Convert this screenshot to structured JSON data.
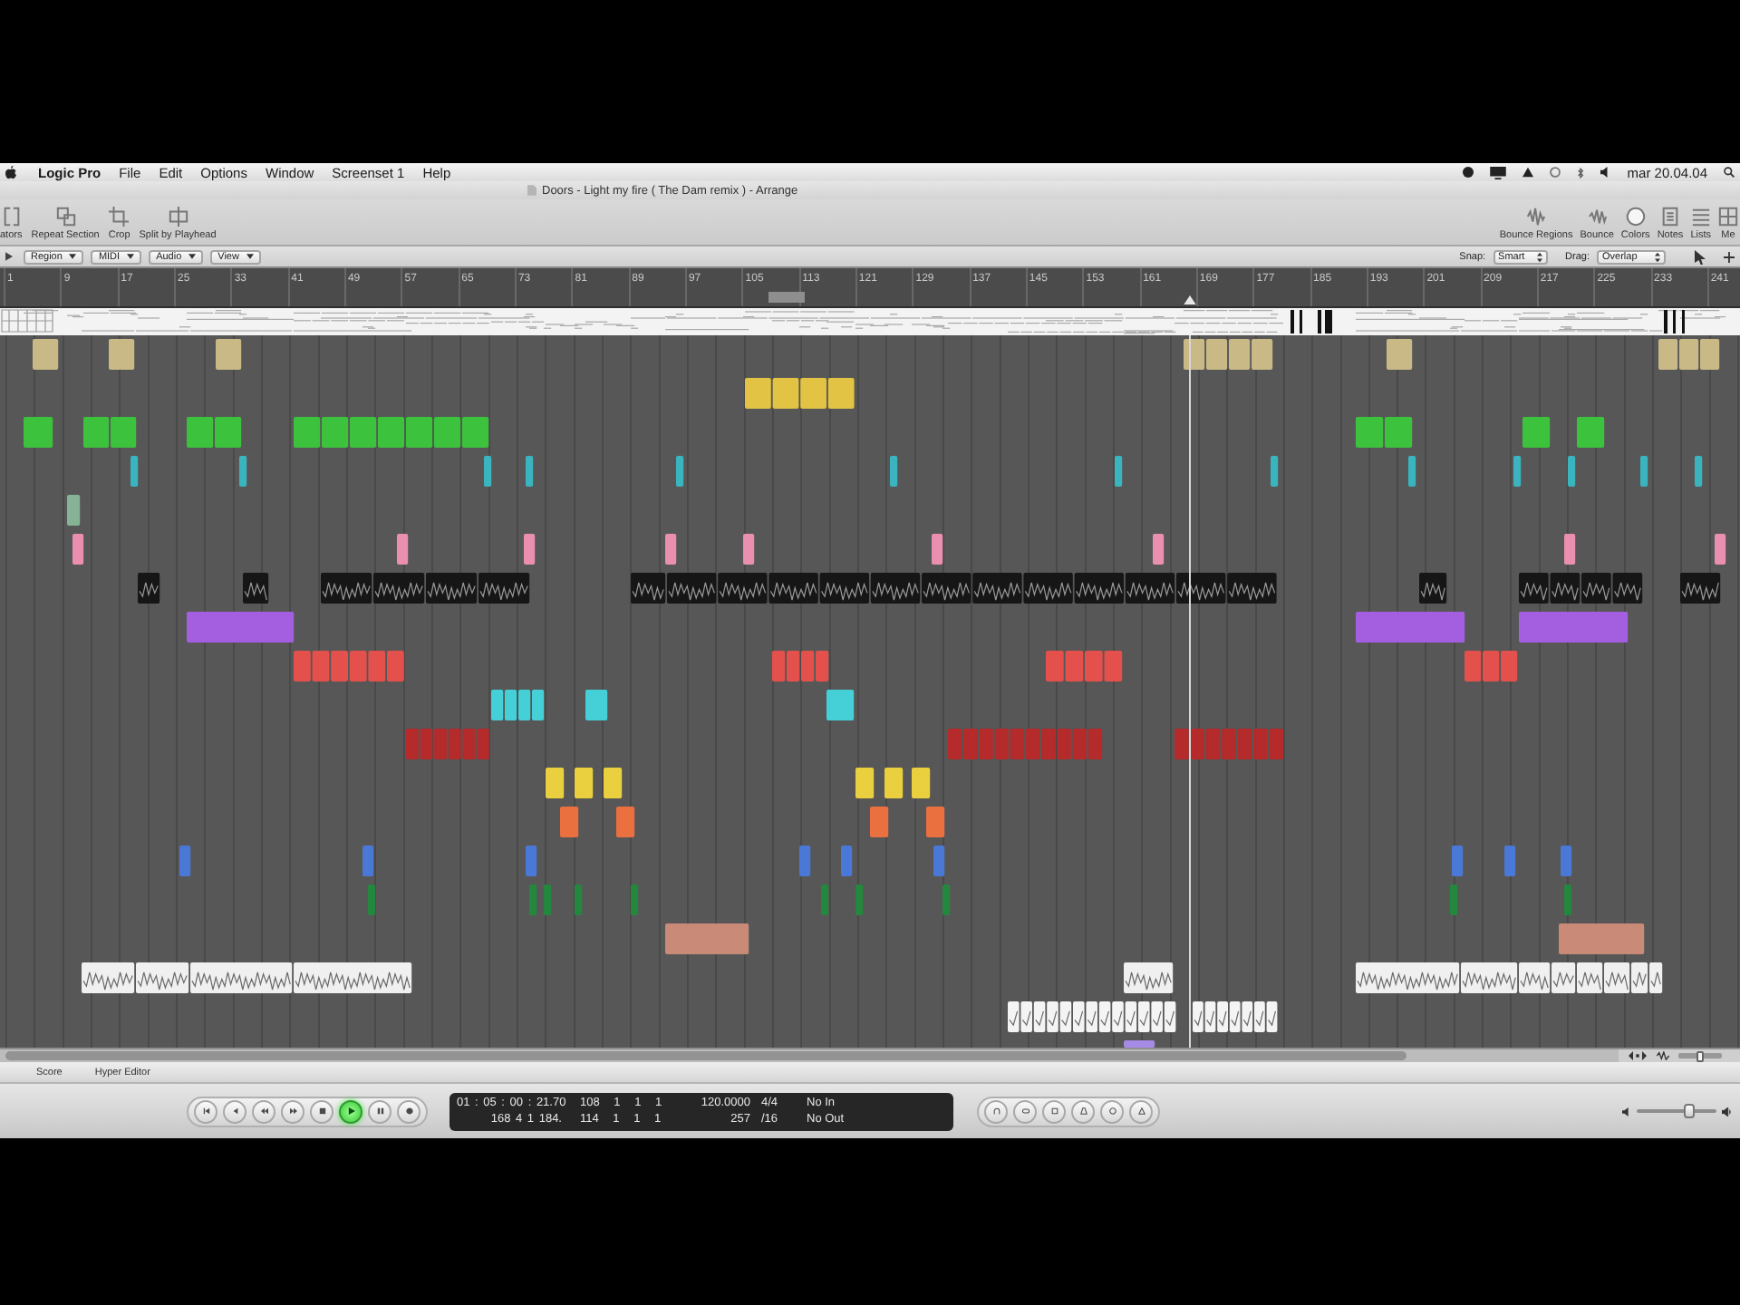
{
  "menu_bar": {
    "items": [
      {
        "label": "Logic Pro",
        "kind": "app"
      },
      {
        "label": "File",
        "kind": "menu"
      },
      {
        "label": "Edit",
        "kind": "menu"
      },
      {
        "label": "Options",
        "kind": "menu"
      },
      {
        "label": "Window",
        "kind": "menu"
      },
      {
        "label": "Screenset 1",
        "kind": "menu"
      },
      {
        "label": "Help",
        "kind": "menu"
      }
    ],
    "clock": "mar 20.04.04"
  },
  "window": {
    "title": "Doors - Light my fire ( The Dam remix ) - Arrange"
  },
  "toolbar": {
    "left": [
      {
        "label": "ators"
      },
      {
        "label": "Repeat Section"
      },
      {
        "label": "Crop"
      },
      {
        "label": "Split by Playhead"
      }
    ],
    "right": [
      {
        "label": "Bounce Regions"
      },
      {
        "label": "Bounce"
      },
      {
        "label": "Colors"
      },
      {
        "label": "Notes"
      },
      {
        "label": "Lists"
      },
      {
        "label": "Me"
      }
    ]
  },
  "local_menus": [
    "Region",
    "MIDI",
    "Audio",
    "View"
  ],
  "snap": {
    "label": "Snap:",
    "value": "Smart"
  },
  "drag": {
    "label": "Drag:",
    "value": "Overlap"
  },
  "ruler": {
    "bars": [
      "1",
      "9",
      "17",
      "25",
      "33",
      "41",
      "49",
      "57",
      "65",
      "73",
      "81",
      "89",
      "97",
      "105",
      "113",
      "121",
      "129",
      "137",
      "145",
      "153",
      "161",
      "169",
      "177",
      "185",
      "193",
      "201",
      "209",
      "217",
      "225",
      "233",
      "241"
    ]
  },
  "tracks": [
    {
      "kind": "midi",
      "color": "#c8b987"
    },
    {
      "kind": "midi",
      "color": "#e2c344"
    },
    {
      "kind": "midi",
      "color": "#3dc23d"
    },
    {
      "kind": "midi",
      "color": "#3ab5bf"
    },
    {
      "kind": "midi",
      "color": "#86b396"
    },
    {
      "kind": "midi",
      "color": "#ea8fb0"
    },
    {
      "kind": "audio",
      "color": "#161616"
    },
    {
      "kind": "midi",
      "color": "#a45fe0"
    },
    {
      "kind": "midi",
      "color": "#e4504c"
    },
    {
      "kind": "midi",
      "color": "#45d0d8"
    },
    {
      "kind": "midi",
      "color": "#b52a2a"
    },
    {
      "kind": "midi",
      "color": "#ead03e"
    },
    {
      "kind": "midi",
      "color": "#ea7040"
    },
    {
      "kind": "midi",
      "color": "#4a78d6"
    },
    {
      "kind": "midi",
      "color": "#23883d"
    },
    {
      "kind": "midi",
      "color": "#c98a78"
    },
    {
      "kind": "audio",
      "color": "#f0f0f0"
    },
    {
      "kind": "audio",
      "color": "#f4f4f4"
    },
    {
      "kind": "midi",
      "color": "#a58ae6"
    }
  ],
  "editor_tabs": [
    {
      "label": "Score",
      "selected": false
    },
    {
      "label": "Hyper Editor",
      "selected": false
    }
  ],
  "transport": {
    "buttons": [
      {
        "kind": "to-start",
        "on": false
      },
      {
        "kind": "back",
        "on": false
      },
      {
        "kind": "rewind",
        "on": false
      },
      {
        "kind": "forward",
        "on": false
      },
      {
        "kind": "stop",
        "on": false
      },
      {
        "kind": "play",
        "on": true
      },
      {
        "kind": "pause",
        "on": false
      },
      {
        "kind": "record",
        "on": false
      }
    ],
    "lcd": {
      "rows": [
        [
          "01 : 05 : 00 : 21.70",
          "108 1 1 1",
          "120.0000",
          "4/4",
          "No In"
        ],
        [
          "168 4 1 184.",
          "114 1 1 1",
          "257",
          "/16",
          "No Out"
        ]
      ]
    }
  },
  "master_volume": {
    "level": 0.67
  },
  "zoom": {
    "level": 0.5
  }
}
